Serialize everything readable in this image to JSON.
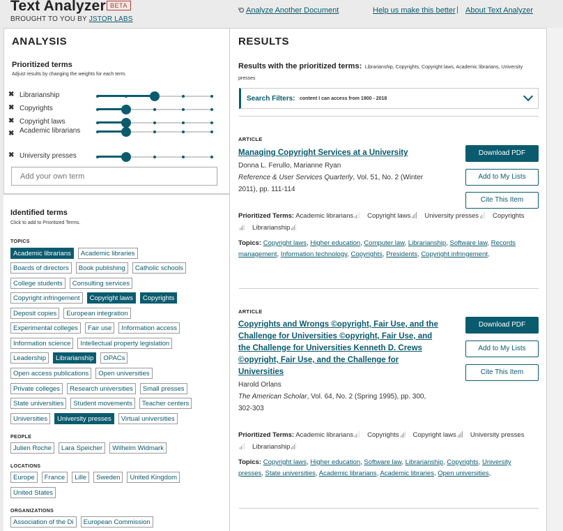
{
  "header": {
    "title": "Text Analyzer",
    "beta": "BETA",
    "brought_prefix": "BROUGHT TO YOU BY ",
    "brought_link": "JSTOR LABS",
    "analyze_another": "Analyze Another Document",
    "help_link": "Help us make this better",
    "separator": "|",
    "about_link": "About Text Analyzer"
  },
  "analysis": {
    "heading": "ANALYSIS",
    "prioritized_title": "Prioritized terms",
    "prioritized_sub": "Adjust results by changing the weights for each term.",
    "terms": [
      {
        "label": "Librarianship",
        "weight": 3
      },
      {
        "label": "Copyrights",
        "weight": 2
      },
      {
        "label": "Copyright laws",
        "weight": 2
      },
      {
        "label": "Academic librarians",
        "weight": 2
      },
      {
        "label": "University presses",
        "weight": 2
      }
    ],
    "weight_max": 5,
    "add_placeholder": "Add your own term"
  },
  "identified": {
    "title": "Identified terms",
    "sub": "Click to add to Prioritized Terms.",
    "groups": [
      {
        "label": "TOPICS",
        "rows": [
          [
            {
              "t": "Academic librarians",
              "on": true
            },
            {
              "t": "Academic libraries",
              "on": false
            }
          ],
          [
            {
              "t": "Boards of directors",
              "on": false
            },
            {
              "t": "Book publishing",
              "on": false
            },
            {
              "t": "Catholic schools",
              "on": false
            }
          ],
          [
            {
              "t": "College students",
              "on": false
            },
            {
              "t": "Consulting services",
              "on": false
            }
          ],
          [
            {
              "t": "Copyright infringement",
              "on": false
            },
            {
              "t": "Copyright laws",
              "on": true
            },
            {
              "t": "Copyrights",
              "on": true
            }
          ],
          [
            {
              "t": "Deposit copies",
              "on": false
            },
            {
              "t": "European integration",
              "on": false
            }
          ],
          [
            {
              "t": "Experimental colleges",
              "on": false
            },
            {
              "t": "Fair use",
              "on": false
            },
            {
              "t": "Information access",
              "on": false
            }
          ],
          [
            {
              "t": "Information science",
              "on": false
            },
            {
              "t": "Intellectual property legislation",
              "on": false
            }
          ],
          [
            {
              "t": "Leadership",
              "on": false
            },
            {
              "t": "Librarianship",
              "on": true
            },
            {
              "t": "OPACs",
              "on": false
            }
          ],
          [
            {
              "t": "Open access publications",
              "on": false
            },
            {
              "t": "Open universities",
              "on": false
            }
          ],
          [
            {
              "t": "Private colleges",
              "on": false
            },
            {
              "t": "Research universities",
              "on": false
            },
            {
              "t": "Small presses",
              "on": false
            }
          ],
          [
            {
              "t": "State universities",
              "on": false
            },
            {
              "t": "Student movements",
              "on": false
            },
            {
              "t": "Teacher centers",
              "on": false
            }
          ],
          [
            {
              "t": "Universities",
              "on": false
            },
            {
              "t": "University presses",
              "on": true
            },
            {
              "t": "Virtual universities",
              "on": false
            }
          ]
        ]
      },
      {
        "label": "PEOPLE",
        "rows": [
          [
            {
              "t": "Julien Roche",
              "on": false
            },
            {
              "t": "Lara Speicher",
              "on": false
            },
            {
              "t": "Wilhelm Widmark",
              "on": false
            }
          ]
        ]
      },
      {
        "label": "LOCATIONS",
        "rows": [
          [
            {
              "t": "Europe",
              "on": false
            },
            {
              "t": "France",
              "on": false
            },
            {
              "t": "Lille",
              "on": false
            },
            {
              "t": "Sweden",
              "on": false
            },
            {
              "t": "United Kingdom",
              "on": false
            }
          ],
          [
            {
              "t": "United States",
              "on": false
            }
          ]
        ]
      },
      {
        "label": "ORGANIZATIONS",
        "rows": [
          [
            {
              "t": "Association of the Di",
              "on": false
            },
            {
              "t": "European Commission",
              "on": false
            }
          ]
        ]
      }
    ]
  },
  "results": {
    "heading": "RESULTS",
    "with_label": "Results with the prioritized terms:",
    "with_terms": "Librarianship, Copyrights, Copyright laws, Academic librarians, University presses",
    "filter_label": "Search Filters:",
    "filter_value": "content I can access from 1900 - 2018",
    "articles": [
      {
        "kind": "ARTICLE",
        "title": "Managing Copyright Services at a University",
        "authors": "Donna L. Ferullo, Marianne Ryan",
        "journal": "Reference & User Services Quarterly",
        "citation": ", Vol. 51, No. 2 (Winter 2011), pp. 111-114",
        "prioritized_label": "Prioritized Terms:",
        "prioritized": [
          {
            "t": "Academic librarians",
            "bars": 2
          },
          {
            "t": "Copyright laws",
            "bars": 4
          },
          {
            "t": "University presses",
            "bars": 2
          },
          {
            "t": "Copyrights",
            "bars": 3
          },
          {
            "t": "Librarianship",
            "bars": 3
          }
        ],
        "topics_label": "Topics:",
        "topics": [
          "Copyright laws",
          "Higher education",
          "Computer law",
          "Librarianship",
          "Software law",
          "Records management",
          "Information technology",
          "Copyrights",
          "Presidents",
          "Copyright infringement"
        ],
        "buttons": {
          "download": "Download PDF",
          "lists": "Add to My Lists",
          "cite": "Cite This Item"
        }
      },
      {
        "kind": "ARTICLE",
        "title": "Copyrights and Wrongs ©opyright, Fair Use, and the Challenge for Universities ©opyright, Fair Use, and the Challenge for Universities Kenneth D. Crews ©opyright, Fair Use, and the Challenge for Universities",
        "authors": "Harold Orlans",
        "journal": "The American Scholar",
        "citation": ", Vol. 64, No. 2 (Spring 1995), pp. 300, 302-303",
        "prioritized_label": "Prioritized Terms:",
        "prioritized": [
          {
            "t": "Academic librarians",
            "bars": 2
          },
          {
            "t": "Copyrights",
            "bars": 3
          },
          {
            "t": "Copyright laws",
            "bars": 4
          },
          {
            "t": "University presses",
            "bars": 2
          },
          {
            "t": "Librarianship",
            "bars": 3
          }
        ],
        "topics_label": "Topics:",
        "topics": [
          "Copyright laws",
          "Higher education",
          "Software law",
          "Librarianship",
          "Copyrights",
          "University presses",
          "State universities",
          "Academic librarians",
          "Academic libraries",
          "Open universities"
        ],
        "buttons": {
          "download": "Download PDF",
          "lists": "Add to My Lists",
          "cite": "Cite This Item"
        }
      }
    ]
  }
}
